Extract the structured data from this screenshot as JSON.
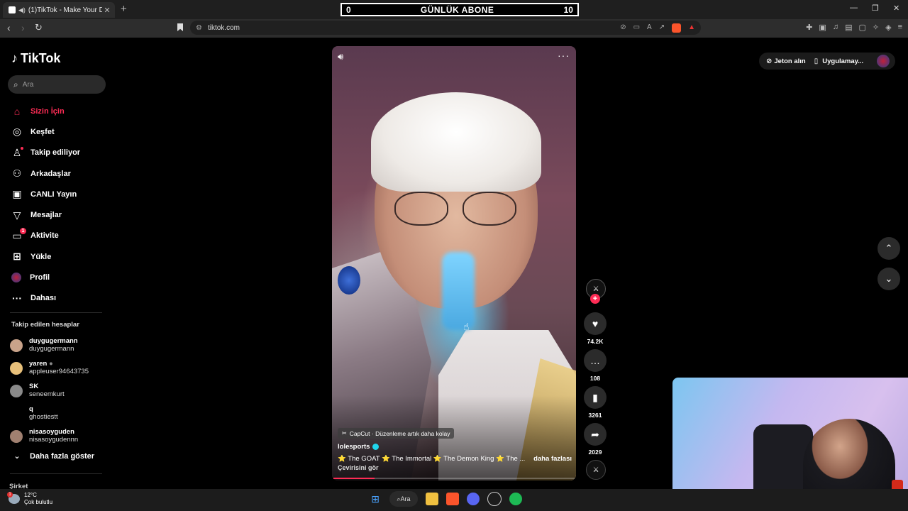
{
  "browser": {
    "tab_title": "(1)TikTok - Make Your Day",
    "url": "tiktok.com"
  },
  "overlay_counter": {
    "left_value": "0",
    "label": "GÜNLÜK ABONE",
    "right_value": "10"
  },
  "sidebar": {
    "logo_text": "TikTok",
    "search_placeholder": "Ara",
    "items": [
      {
        "label": "Sizin İçin",
        "icon": "home-icon"
      },
      {
        "label": "Keşfet",
        "icon": "compass-icon"
      },
      {
        "label": "Takip ediliyor",
        "icon": "following-icon"
      },
      {
        "label": "Arkadaşlar",
        "icon": "friends-icon"
      },
      {
        "label": "CANLI Yayın",
        "icon": "live-icon"
      },
      {
        "label": "Mesajlar",
        "icon": "message-icon"
      },
      {
        "label": "Aktivite",
        "icon": "activity-icon",
        "badge": "1"
      },
      {
        "label": "Yükle",
        "icon": "upload-icon"
      },
      {
        "label": "Profil",
        "icon": "profile-icon"
      },
      {
        "label": "Dahası",
        "icon": "more-icon"
      }
    ],
    "following_title": "Takip edilen hesaplar",
    "accounts": [
      {
        "name": "duygugermann",
        "username": "duygugermann"
      },
      {
        "name": "yaren",
        "username": "appleuser94643735"
      },
      {
        "name": "SK",
        "username": "seneemkurt"
      },
      {
        "name": "q",
        "username": "ghostiestt"
      },
      {
        "name": "nisasoyguden",
        "username": "nisasoygudennn"
      }
    ],
    "show_more": "Daha fazla göster",
    "company": "Şirket"
  },
  "video": {
    "capcut_label": "CapCut · Düzenleme artık daha kolay",
    "author": "lolesports",
    "description": [
      "⭐ The GOAT ⭐ The Immortal ⭐ The Demon King ⭐ The ..."
    ],
    "more_link": "daha fazlası",
    "translate": "Çevirisini gör",
    "progress": 0.17
  },
  "actions": {
    "likes": "74.2K",
    "comments": "108",
    "saves": "3261",
    "shares": "2029"
  },
  "topbar_right": {
    "coins": "Jeton alın",
    "app": "Uygulamay..."
  },
  "taskbar": {
    "temp": "12°C",
    "weather": "Çok bulutlu",
    "search": "Ara"
  }
}
